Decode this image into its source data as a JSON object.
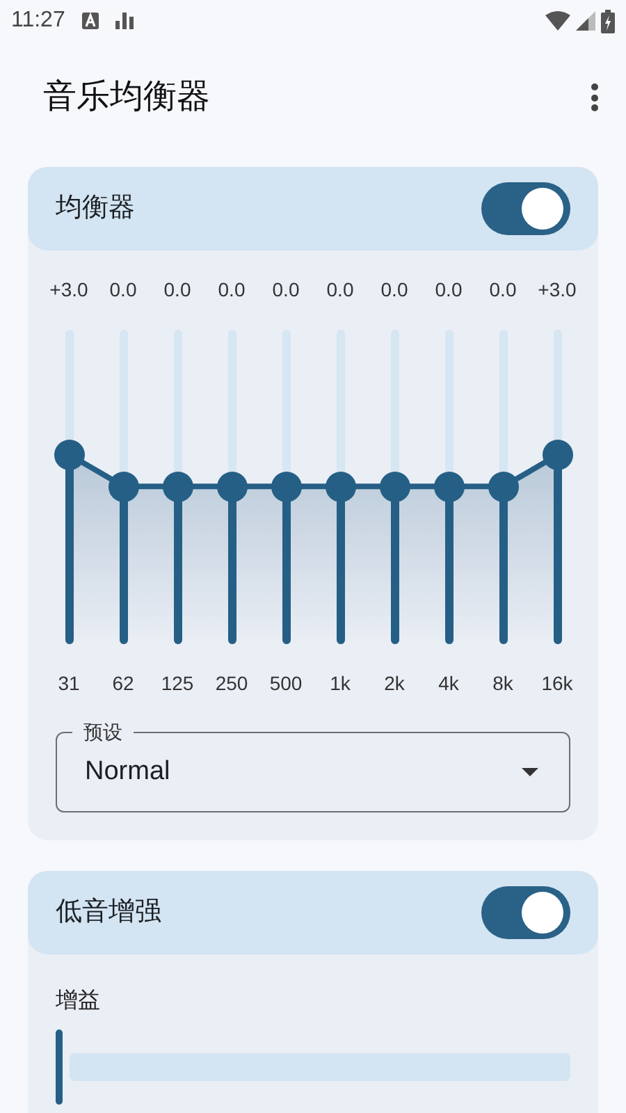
{
  "status_bar": {
    "time": "11:27"
  },
  "app_bar": {
    "title": "音乐均衡器"
  },
  "equalizer": {
    "title": "均衡器",
    "on": true,
    "bands": [
      {
        "reading": "+3.0",
        "label": "31",
        "level": 0.6
      },
      {
        "reading": "0.0",
        "label": "62",
        "level": 0.5
      },
      {
        "reading": "0.0",
        "label": "125",
        "level": 0.5
      },
      {
        "reading": "0.0",
        "label": "250",
        "level": 0.5
      },
      {
        "reading": "0.0",
        "label": "500",
        "level": 0.5
      },
      {
        "reading": "0.0",
        "label": "1k",
        "level": 0.5
      },
      {
        "reading": "0.0",
        "label": "2k",
        "level": 0.5
      },
      {
        "reading": "0.0",
        "label": "4k",
        "level": 0.5
      },
      {
        "reading": "0.0",
        "label": "8k",
        "level": 0.5
      },
      {
        "reading": "+3.0",
        "label": "16k",
        "level": 0.6
      }
    ],
    "preset": {
      "label": "预设",
      "value": "Normal"
    }
  },
  "bass_boost": {
    "title": "低音增强",
    "on": true,
    "gain": {
      "label": "增益",
      "level": 0
    }
  }
}
